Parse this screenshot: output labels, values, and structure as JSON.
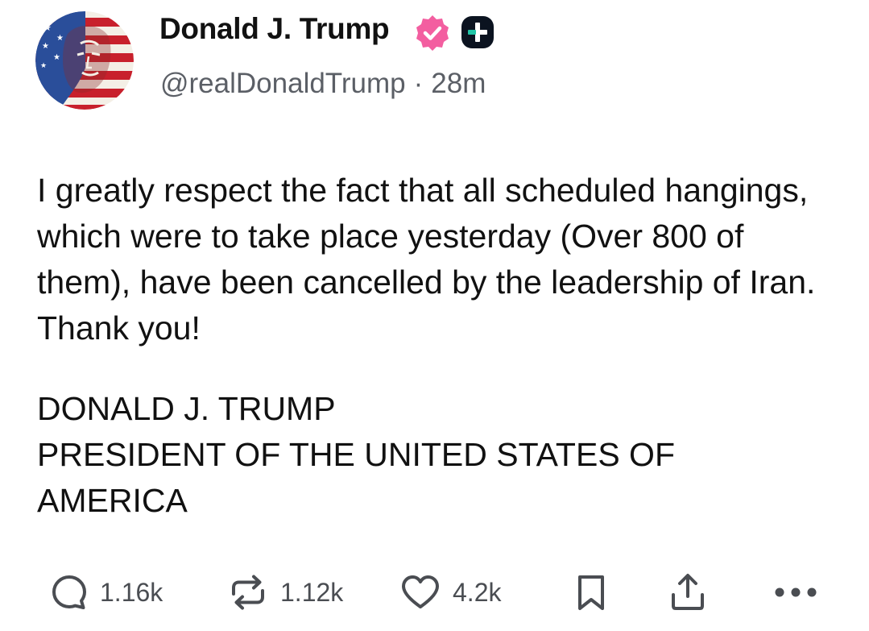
{
  "author": {
    "display_name": "Donald J. Trump",
    "handle": "@realDonaldTrump",
    "separator": "·",
    "time": "28m"
  },
  "post": {
    "body": "I greatly respect the fact that all scheduled hangings, which were to take place yesterday (Over 800 of them), have been cancelled by the leadership of Iran. Thank you!",
    "signature_lines": [
      "DONALD J. TRUMP",
      "PRESIDENT OF THE UNITED STATES OF",
      "AMERICA"
    ]
  },
  "actions": {
    "replies": "1.16k",
    "reposts": "1.12k",
    "likes": "4.2k"
  },
  "icons": {
    "verified": "verified-badge-icon",
    "plus": "plus-badge-icon",
    "reply": "reply-icon",
    "repost": "repost-icon",
    "like": "heart-icon",
    "bookmark": "bookmark-icon",
    "share": "share-icon",
    "more": "more-icon"
  },
  "colors": {
    "verified": "#f35ea0",
    "text": "#111111",
    "muted": "#5b5f66",
    "action_icon": "#4a4d52",
    "plus_badge_bg": "#0b1320",
    "plus_badge_accent": "#21c4a6"
  }
}
